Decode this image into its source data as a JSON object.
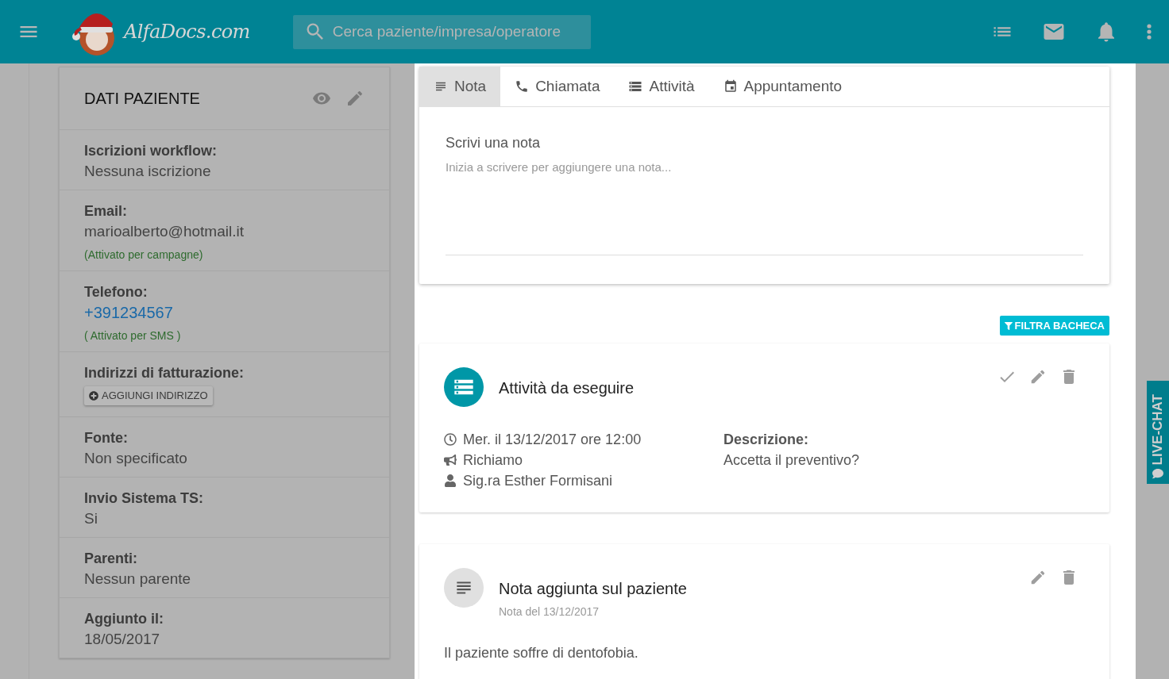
{
  "header": {
    "logo_text": "AlfaDocs.com",
    "search": {
      "placeholder": "Cerca paziente/impresa/operatore"
    }
  },
  "patient_card": {
    "title": "DATI PAZIENTE",
    "fields": [
      {
        "kind": "text",
        "label": "Iscrizioni workflow:",
        "value": "Nessuna iscrizione"
      },
      {
        "kind": "text",
        "label": "Email:",
        "value": "marioalberto@hotmail.it",
        "note": "(Attivato per campagne)"
      },
      {
        "kind": "link",
        "label": "Telefono:",
        "value": "+391234567",
        "note": "( Attivato per SMS )"
      },
      {
        "kind": "button",
        "label": "Indirizzi di fatturazione:",
        "value": "AGGIUNGI INDIRIZZO"
      },
      {
        "kind": "text",
        "label": "Fonte:",
        "value": "Non specificato"
      },
      {
        "kind": "text",
        "label": "Invio Sistema TS:",
        "value": "Si"
      },
      {
        "kind": "text",
        "label": "Parenti:",
        "value": "Nessun parente"
      },
      {
        "kind": "text",
        "label": "Aggiunto il:",
        "value": "18/05/2017"
      }
    ]
  },
  "compose": {
    "tabs": [
      {
        "kind": "note",
        "label": "Nota",
        "selected": true
      },
      {
        "kind": "call",
        "label": "Chiamata",
        "selected": false
      },
      {
        "kind": "task",
        "label": "Attività",
        "selected": false
      },
      {
        "kind": "event",
        "label": "Appuntamento",
        "selected": false
      }
    ],
    "title": "Scrivi una nota",
    "placeholder": "Inizia a scrivere per aggiungere una nota..."
  },
  "filter_button": "FILTRA BACHECA",
  "feed": [
    {
      "kind": "task",
      "title": "Attività da eseguire",
      "done_action": true,
      "details": [
        "Mer. il 13/12/2017 ore 12:00",
        "Richiamo",
        "Sig.ra Esther Formisani"
      ],
      "description_label": "Descrizione:",
      "description": "Accetta il preventivo?"
    },
    {
      "kind": "note",
      "title": "Nota aggiunta sul paziente",
      "done_action": false,
      "subtitle": "Nota del 13/12/2017",
      "body": "Il paziente soffre di dentofobia."
    }
  ],
  "live_chat": "LIVE-CHAT"
}
